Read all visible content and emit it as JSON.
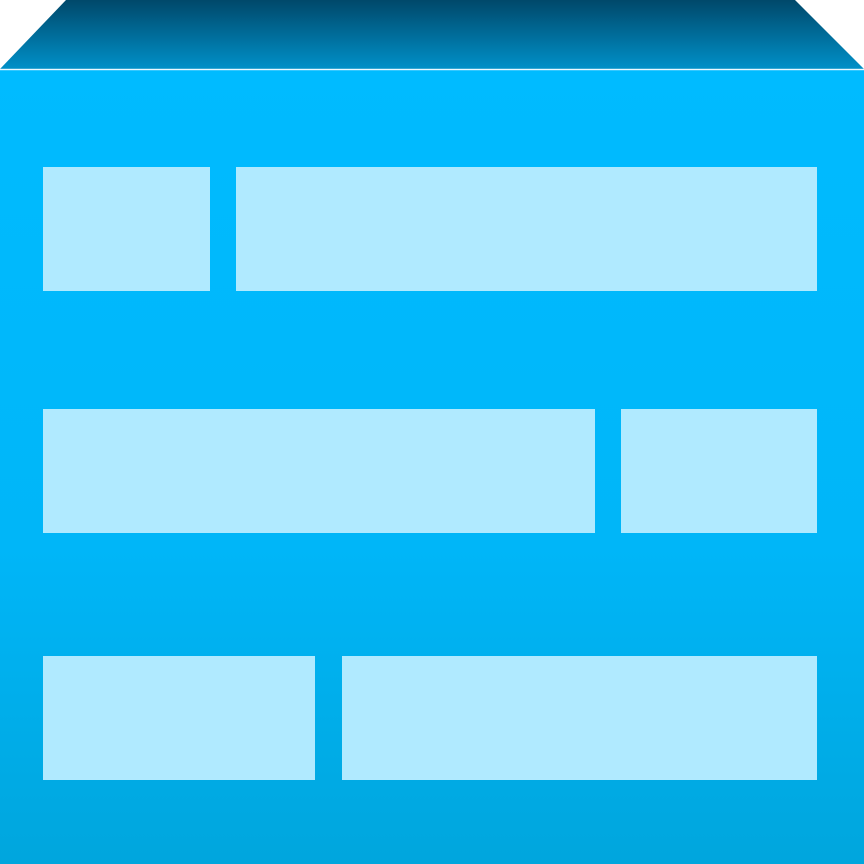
{
  "icon": {
    "name": "firewall-icon",
    "colors": {
      "front_top": "#00bbff",
      "front_bottom": "#00a6dd",
      "top_face_light": "#0090c8",
      "top_face_dark": "#00486a",
      "edge_highlight": "#e8f8ff",
      "brick": "#b0eaff"
    },
    "brick_rows": [
      {
        "row": 1,
        "bricks": [
          "short",
          "long"
        ]
      },
      {
        "row": 2,
        "bricks": [
          "long",
          "short"
        ]
      },
      {
        "row": 3,
        "bricks": [
          "medium",
          "long"
        ]
      }
    ]
  }
}
